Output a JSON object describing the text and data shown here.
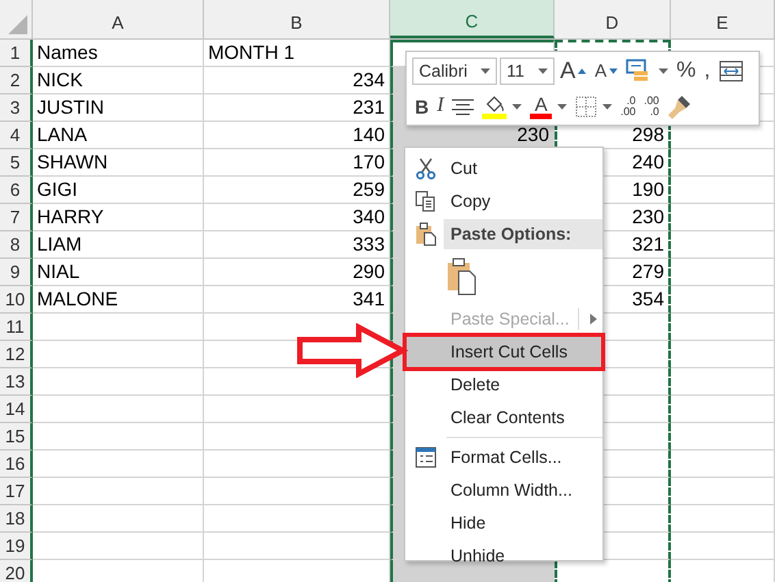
{
  "grid": {
    "columns": [
      {
        "letter": "A",
        "kind": "text",
        "selected": false,
        "cut": false
      },
      {
        "letter": "B",
        "kind": "number",
        "selected": false,
        "cut": false
      },
      {
        "letter": "C",
        "kind": "number",
        "selected": true,
        "cut": false
      },
      {
        "letter": "D",
        "kind": "number",
        "selected": false,
        "cut": true
      },
      {
        "letter": "E",
        "kind": "number",
        "selected": false,
        "cut": false
      }
    ],
    "rows": [
      {
        "label": "1",
        "kind": "heading",
        "cells": {
          "A": "Names",
          "B": "MONTH 1"
        }
      },
      {
        "label": "2",
        "kind": "data",
        "cells": {
          "A": "NICK",
          "B": "234"
        }
      },
      {
        "label": "3",
        "kind": "data",
        "cells": {
          "A": "JUSTIN",
          "B": "231"
        }
      },
      {
        "label": "4",
        "kind": "data",
        "cells": {
          "A": "LANA",
          "B": "140",
          "C": "230",
          "D": "298"
        }
      },
      {
        "label": "5",
        "kind": "data",
        "cells": {
          "A": "SHAWN",
          "B": "170",
          "D": "240"
        }
      },
      {
        "label": "6",
        "kind": "data",
        "cells": {
          "A": "GIGI",
          "B": "259",
          "D": "190"
        }
      },
      {
        "label": "7",
        "kind": "data",
        "cells": {
          "A": "HARRY",
          "B": "340",
          "D": "230"
        }
      },
      {
        "label": "8",
        "kind": "data",
        "cells": {
          "A": "LIAM",
          "B": "333",
          "D": "321"
        }
      },
      {
        "label": "9",
        "kind": "data",
        "cells": {
          "A": "NIAL",
          "B": "290",
          "D": "279"
        }
      },
      {
        "label": "10",
        "kind": "data",
        "cells": {
          "A": "MALONE",
          "B": "341",
          "D": "354"
        }
      },
      {
        "label": "11",
        "kind": "data",
        "cells": {}
      },
      {
        "label": "12",
        "kind": "data",
        "cells": {}
      },
      {
        "label": "13",
        "kind": "data",
        "cells": {}
      },
      {
        "label": "14",
        "kind": "data",
        "cells": {}
      },
      {
        "label": "15",
        "kind": "data",
        "cells": {}
      },
      {
        "label": "16",
        "kind": "data",
        "cells": {}
      },
      {
        "label": "17",
        "kind": "data",
        "cells": {}
      },
      {
        "label": "18",
        "kind": "data",
        "cells": {}
      },
      {
        "label": "19",
        "kind": "data",
        "cells": {}
      },
      {
        "label": "20",
        "kind": "data",
        "cells": {}
      }
    ]
  },
  "mini_toolbar": {
    "font_field": {
      "value": "Calibri"
    },
    "size_field": {
      "value": "11"
    },
    "top_buttons": [
      {
        "kind": "grow-font",
        "glyph": "A",
        "dropdown": false
      },
      {
        "kind": "shrink-font",
        "glyph": "A",
        "dropdown": false
      },
      {
        "kind": "cell-styles",
        "dropdown": true
      },
      {
        "kind": "glyph",
        "glyph": "%",
        "dropdown": false
      },
      {
        "kind": "glyph",
        "glyph": ",",
        "dropdown": false
      },
      {
        "kind": "autofit",
        "dropdown": false
      }
    ],
    "bottom_buttons": [
      {
        "kind": "bold",
        "glyph": "B",
        "dropdown": false
      },
      {
        "kind": "italic",
        "glyph": "I",
        "dropdown": false
      },
      {
        "kind": "align",
        "dropdown": false
      },
      {
        "kind": "fill-color",
        "color": "#ffff00",
        "dropdown": true
      },
      {
        "kind": "font-color",
        "glyph": "A",
        "color": "#ff0000",
        "dropdown": true
      },
      {
        "kind": "borders",
        "dropdown": true
      },
      {
        "kind": "decimal",
        "lines": [
          ".0",
          ".00"
        ],
        "dropdown": false
      },
      {
        "kind": "decimal",
        "lines": [
          ".00",
          ".0"
        ],
        "dropdown": false
      },
      {
        "kind": "format-painter",
        "dropdown": false
      }
    ]
  },
  "context_menu": {
    "items": [
      {
        "kind": "cut",
        "label": "Cut",
        "selected": false,
        "disabled": false,
        "callout": false
      },
      {
        "kind": "copy",
        "label": "Copy",
        "selected": false,
        "disabled": false,
        "callout": false
      },
      {
        "kind": "heading",
        "label": "Paste Options:"
      },
      {
        "kind": "paste-icon"
      },
      {
        "kind": "submenu",
        "label": "Paste Special...",
        "selected": false,
        "disabled": true,
        "callout": false
      },
      {
        "kind": "item",
        "label": "Insert Cut Cells",
        "selected": true,
        "disabled": false,
        "callout": true
      },
      {
        "kind": "item",
        "label": "Delete",
        "selected": false,
        "disabled": false,
        "callout": false
      },
      {
        "kind": "item",
        "label": "Clear Contents",
        "selected": false,
        "disabled": false,
        "callout": false
      },
      {
        "kind": "separator"
      },
      {
        "kind": "format",
        "label": "Format Cells...",
        "selected": false,
        "disabled": false,
        "callout": false
      },
      {
        "kind": "item",
        "label": "Column Width...",
        "selected": false,
        "disabled": false,
        "callout": false
      },
      {
        "kind": "item",
        "label": "Hide",
        "selected": false,
        "disabled": false,
        "callout": false
      },
      {
        "kind": "item",
        "label": "Unhide",
        "selected": false,
        "disabled": false,
        "callout": false
      }
    ]
  }
}
